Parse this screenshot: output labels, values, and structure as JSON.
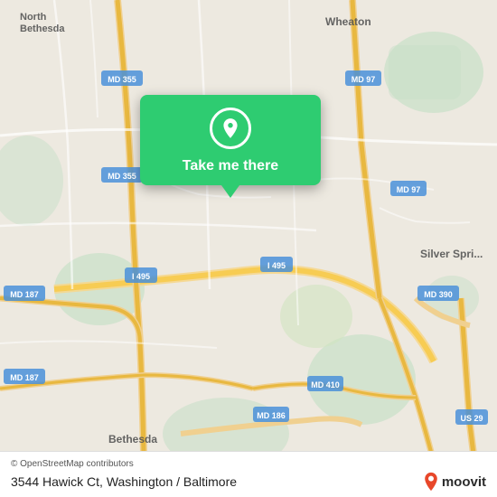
{
  "map": {
    "background_color": "#ede9e0",
    "center_lat": 39.01,
    "center_lon": -77.07
  },
  "popup": {
    "label": "Take me there",
    "background_color": "#2ecc71",
    "pin_icon": "map-pin"
  },
  "bottom_bar": {
    "osm_credit": "© OpenStreetMap contributors",
    "address": "3544 Hawick Ct, Washington / Baltimore",
    "logo_text": "moovit"
  },
  "road_labels": [
    "MD 355",
    "MD 187",
    "MD 97",
    "MD 390",
    "MD 410",
    "MD 186",
    "I 495",
    "US 29",
    "North Bethesda",
    "Wheaton",
    "Silver Spring",
    "Bethesda"
  ]
}
